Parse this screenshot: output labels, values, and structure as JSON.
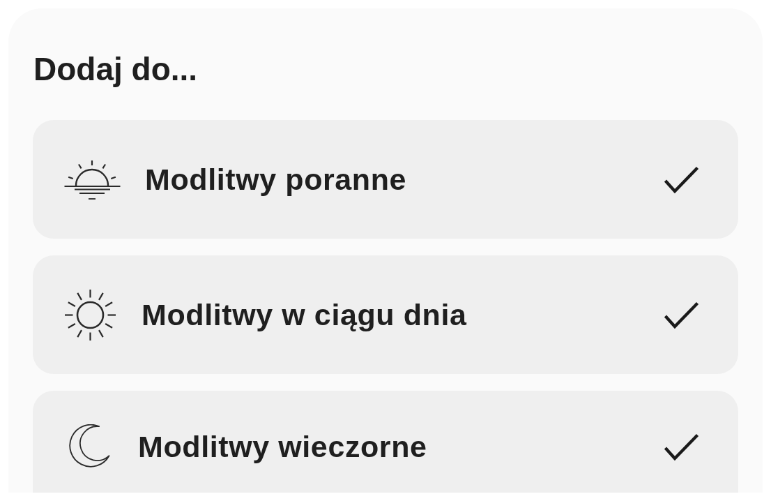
{
  "dialog": {
    "title": "Dodaj do...",
    "options": [
      {
        "kind": "morning",
        "label": "Modlitwy poranne",
        "checked": true
      },
      {
        "kind": "daytime",
        "label": "Modlitwy w ciągu dnia",
        "checked": true
      },
      {
        "kind": "evening",
        "label": "Modlitwy wieczorne",
        "checked": true
      }
    ]
  }
}
